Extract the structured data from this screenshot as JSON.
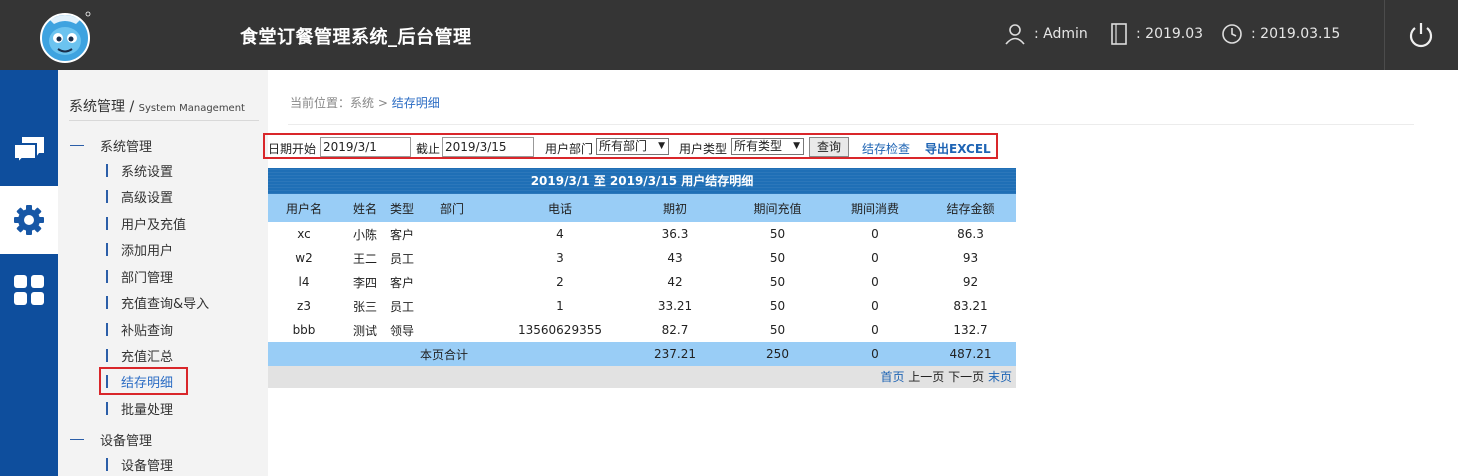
{
  "header": {
    "title": "食堂订餐管理系统_后台管理",
    "user": ": Admin",
    "period": ": 2019.03",
    "date": ": 2019.03.15"
  },
  "sidebar": {
    "heading": "系统管理",
    "heading_en": "System Management",
    "groups": [
      {
        "label": "系统管理",
        "items": [
          "系统设置",
          "高级设置",
          "用户及充值",
          "添加用户",
          "部门管理",
          "充值查询&导入",
          "补贴查询",
          "充值汇总",
          "结存明细",
          "批量处理"
        ]
      },
      {
        "label": "设备管理",
        "items": [
          "设备管理"
        ]
      }
    ],
    "active_item": "结存明细"
  },
  "breadcrumb": {
    "prefix": "当前位置：系统",
    "sep": ">",
    "current": "结存明细"
  },
  "filter": {
    "start_label": "日期开始",
    "start_value": "2019/3/1",
    "end_label": "截止",
    "end_value": "2019/3/15",
    "dept_label": "用户部门",
    "dept_value": "所有部门",
    "type_label": "用户类型",
    "type_value": "所有类型",
    "query_button": "查询",
    "check_link": "结存检查",
    "export_link": "导出EXCEL"
  },
  "report": {
    "title": "2019/3/1 至 2019/3/15 用户结存明细",
    "columns": [
      "用户名",
      "姓名",
      "类型",
      "部门",
      "电话",
      "期初",
      "期间充值",
      "期间消费",
      "结存金额"
    ],
    "rows": [
      [
        "xc",
        "小陈",
        "客户",
        "",
        "4",
        "36.3",
        "50",
        "0",
        "86.3"
      ],
      [
        "w2",
        "王二",
        "员工",
        "",
        "3",
        "43",
        "50",
        "0",
        "93"
      ],
      [
        "l4",
        "李四",
        "客户",
        "",
        "2",
        "42",
        "50",
        "0",
        "92"
      ],
      [
        "z3",
        "张三",
        "员工",
        "",
        "1",
        "33.21",
        "50",
        "0",
        "83.21"
      ],
      [
        "bbb",
        "测试",
        "领导",
        "",
        "13560629355",
        "82.7",
        "50",
        "0",
        "132.7"
      ]
    ],
    "total": {
      "label": "本页合计",
      "opening": "237.21",
      "recharge": "250",
      "consume": "0",
      "balance": "487.21"
    }
  },
  "pager": {
    "first": "首页",
    "prev": "上一页",
    "next": "下一页",
    "last": "末页"
  },
  "colors": {
    "header_bg": "#353535",
    "rail_bg": "#0e4e9d",
    "table_title_bg": "#1f6fb6",
    "table_head_bg": "#99cdf6",
    "highlight": "#d9262a",
    "link": "#1e64b4"
  },
  "icons": [
    "logo-mascot",
    "user-icon",
    "book-icon",
    "clock-icon",
    "power-icon",
    "chat-icon",
    "gear-icon",
    "grid-icon"
  ]
}
